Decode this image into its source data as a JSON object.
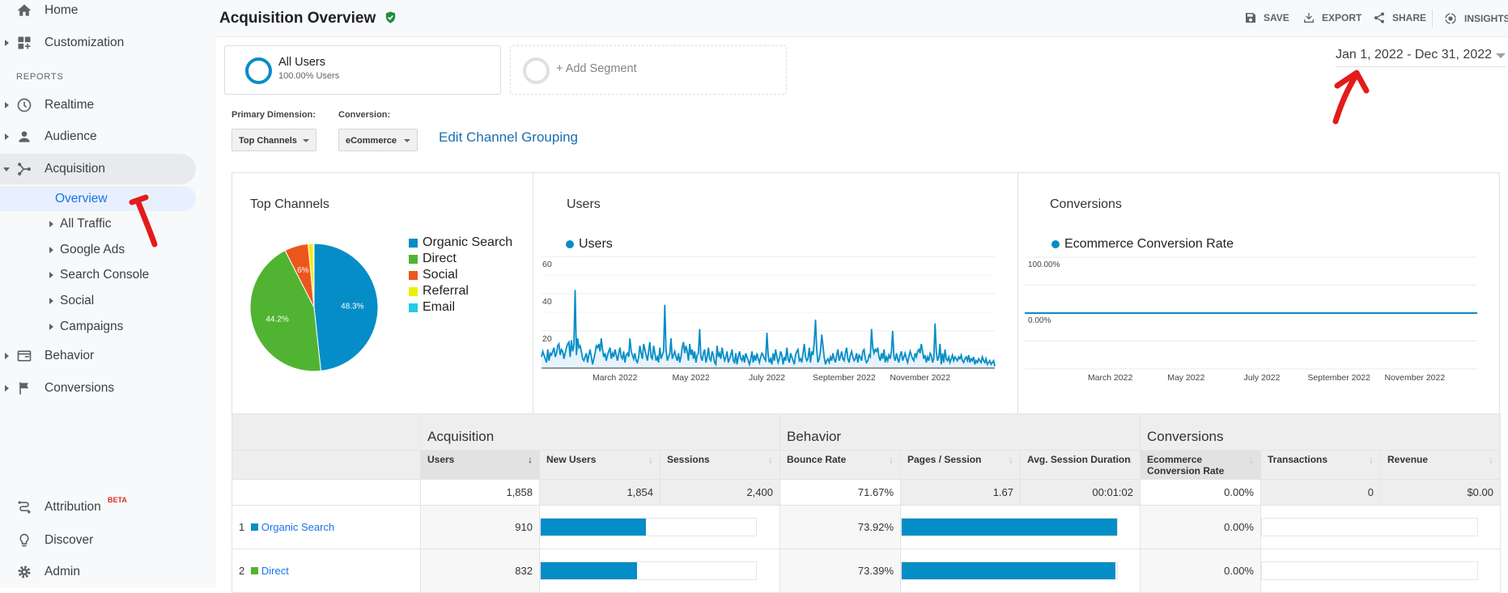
{
  "sidebar": {
    "top": [
      {
        "label": "Home",
        "icon": "home-icon"
      },
      {
        "label": "Customization",
        "icon": "dashboard-icon"
      }
    ],
    "section": "REPORTS",
    "reports": [
      {
        "label": "Realtime",
        "icon": "clock-icon"
      },
      {
        "label": "Audience",
        "icon": "person-icon"
      },
      {
        "label": "Acquisition",
        "icon": "acquisition-icon"
      }
    ],
    "acq_children": [
      "Overview",
      "All Traffic",
      "Google Ads",
      "Search Console",
      "Social",
      "Campaigns"
    ],
    "more": [
      {
        "label": "Behavior",
        "icon": "behavior-icon"
      },
      {
        "label": "Conversions",
        "icon": "flag-icon"
      }
    ],
    "bottom": [
      {
        "label": "Attribution",
        "badge": "BETA",
        "icon": "attribution-icon"
      },
      {
        "label": "Discover",
        "icon": "lightbulb-icon"
      },
      {
        "label": "Admin",
        "icon": "gear-icon"
      }
    ]
  },
  "header": {
    "title": "Acquisition Overview",
    "toolbar": {
      "save": "SAVE",
      "export": "EXPORT",
      "share": "SHARE",
      "insights": "INSIGHTS"
    }
  },
  "segments": {
    "all_users": "All Users",
    "all_users_sub": "100.00% Users",
    "add": "+ Add Segment"
  },
  "date_range": "Jan 1, 2022 - Dec 31, 2022",
  "controls": {
    "primary_label": "Primary Dimension:",
    "primary_value": "Top Channels",
    "conversion_label": "Conversion:",
    "conversion_value": "eCommerce",
    "edit_link": "Edit Channel Grouping"
  },
  "colors": {
    "blue": "#058dc7",
    "green": "#50b432",
    "orange": "#ed561b",
    "yellow": "#edef00",
    "cyan": "#24cbe5",
    "annotation": "#e31b1b"
  },
  "chart_data": [
    {
      "type": "pie",
      "title": "Top Channels",
      "categories": [
        "Organic Search",
        "Direct",
        "Social",
        "Referral",
        "Email"
      ],
      "values": [
        48.3,
        44.2,
        6.0,
        1.3,
        0.2
      ],
      "slice_labels": [
        "48.3%",
        "44.2%",
        "6%",
        "",
        ""
      ],
      "colors": [
        "#058dc7",
        "#50b432",
        "#ed561b",
        "#edef00",
        "#24cbe5"
      ],
      "legend": "right"
    },
    {
      "type": "area",
      "title": "Users",
      "series": [
        {
          "name": "Users",
          "values": [
            6,
            9,
            7,
            5,
            3,
            10,
            4,
            8,
            7,
            9,
            11,
            6,
            8,
            12,
            13,
            7,
            10,
            9,
            5,
            8,
            11,
            13,
            14,
            6,
            15,
            9,
            12,
            42,
            7,
            16,
            11,
            12,
            9,
            5,
            4,
            6,
            8,
            3,
            7,
            10,
            6,
            2,
            5,
            8,
            12,
            11,
            13,
            9,
            16,
            10,
            6,
            8,
            4,
            7,
            9,
            11,
            5,
            8,
            6,
            10,
            7,
            4,
            8,
            11,
            6,
            5,
            9,
            3,
            7,
            8,
            6,
            16,
            9,
            7,
            5,
            8,
            4,
            3,
            6,
            12,
            8,
            5,
            13,
            10,
            7,
            4,
            9,
            14,
            6,
            5,
            12,
            8,
            4,
            6,
            3,
            11,
            5,
            7,
            9,
            34,
            10,
            4,
            6,
            8,
            16,
            5,
            7,
            9,
            6,
            4,
            8,
            3,
            6,
            11,
            14,
            8,
            12,
            9,
            4,
            13,
            7,
            10,
            5,
            9,
            3,
            7,
            8,
            21,
            6,
            4,
            8,
            10,
            3,
            6,
            11,
            5,
            4,
            9,
            7,
            3,
            2,
            12,
            6,
            8,
            5,
            11,
            7,
            4,
            6,
            9,
            3,
            5,
            7,
            10,
            4,
            3,
            8,
            2,
            6,
            9,
            5,
            4,
            7,
            3,
            8,
            6,
            4,
            2,
            5,
            9,
            3,
            7,
            4,
            8,
            5,
            3,
            6,
            8,
            7,
            5,
            4,
            19,
            7,
            3,
            5,
            2,
            8,
            4,
            10,
            6,
            3,
            5,
            9,
            7,
            2,
            6,
            4,
            11,
            5,
            3,
            8,
            6,
            4,
            2,
            7,
            9,
            10,
            4,
            5,
            3,
            8,
            13,
            6,
            4,
            5,
            11,
            3,
            9,
            7,
            14,
            26,
            10,
            3,
            5,
            9,
            18,
            12,
            6,
            2,
            4,
            5,
            3,
            6,
            4,
            8,
            5,
            3,
            7,
            10,
            4,
            6,
            9,
            5,
            4,
            8,
            11,
            5,
            3,
            7,
            9,
            6,
            4,
            5,
            8,
            3,
            7,
            6,
            4,
            9,
            10,
            5,
            3,
            4,
            7,
            6,
            21,
            11,
            8,
            10,
            9,
            11,
            6,
            4,
            8,
            5,
            10,
            3,
            6,
            4,
            7,
            5,
            9,
            20,
            6,
            4,
            8,
            5,
            3,
            7,
            9,
            4,
            6,
            8,
            5,
            3,
            6,
            9,
            7,
            5,
            4,
            8,
            6,
            9,
            10,
            8,
            13,
            9,
            5,
            7,
            3,
            6,
            4,
            8,
            7,
            3,
            5,
            24,
            9,
            4,
            6,
            13,
            2,
            8,
            3,
            10,
            5,
            4,
            6,
            3,
            5,
            7,
            4,
            6,
            5,
            4,
            6,
            5,
            7,
            4,
            3,
            5,
            6,
            4,
            7,
            3,
            5,
            4,
            6,
            2,
            4,
            3,
            5,
            4,
            3,
            6,
            4,
            3,
            5,
            2,
            3,
            4,
            2,
            3,
            4,
            1
          ]
        }
      ],
      "x_range": [
        "2022-01-01",
        "2022-12-31"
      ],
      "yticks": [
        "60",
        "40",
        "20"
      ],
      "ylim": [
        0,
        60
      ],
      "xticks": [
        "March 2022",
        "May 2022",
        "July 2022",
        "September 2022",
        "November 2022"
      ],
      "grid": true
    },
    {
      "type": "line",
      "title": "Conversions",
      "series": [
        {
          "name": "Ecommerce Conversion Rate",
          "values": [
            0
          ]
        }
      ],
      "yticks": [
        "100.00%",
        "0.00%"
      ],
      "ylim": [
        -100,
        100
      ],
      "xticks": [
        "March 2022",
        "May 2022",
        "July 2022",
        "September 2022",
        "November 2022"
      ],
      "grid": true
    }
  ],
  "table": {
    "groups": [
      "Acquisition",
      "Behavior",
      "Conversions"
    ],
    "columns": [
      "Users",
      "New Users",
      "Sessions",
      "Bounce Rate",
      "Pages / Session",
      "Avg. Session Duration",
      "Ecommerce Conversion Rate",
      "Transactions",
      "Revenue"
    ],
    "totals": [
      "1,858",
      "1,854",
      "2,400",
      "71.67%",
      "1.67",
      "00:01:02",
      "0.00%",
      "0",
      "$0.00"
    ],
    "rows": [
      {
        "rank": "1",
        "channel": "Organic Search",
        "color": "#058dc7",
        "users": "910",
        "users_share": 0.49,
        "bounce": "73.92%",
        "bounce_share": 1.0,
        "conv": "0.00%",
        "conv_share": 0
      },
      {
        "rank": "2",
        "channel": "Direct",
        "color": "#50b432",
        "users": "832",
        "users_share": 0.448,
        "bounce": "73.39%",
        "bounce_share": 0.993,
        "conv": "0.00%",
        "conv_share": 0
      }
    ]
  }
}
